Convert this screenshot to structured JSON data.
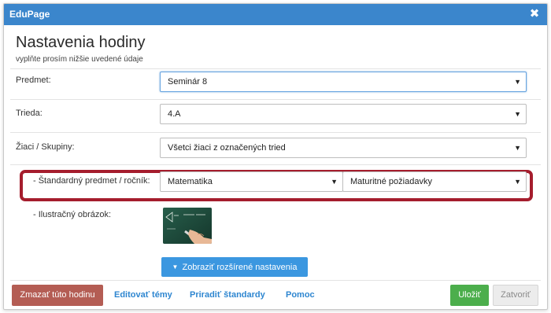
{
  "window": {
    "app_name": "EduPage",
    "close_glyph": "✖"
  },
  "header": {
    "title": "Nastavenia hodiny",
    "subtitle": "vyplňte prosím nižšie uvedené údaje"
  },
  "form": {
    "subject": {
      "label": "Predmet:",
      "value": "Seminár 8"
    },
    "class": {
      "label": "Trieda:",
      "value": "4.A"
    },
    "students": {
      "label": "Žiaci / Skupiny:",
      "value": "Všetci žiaci z označených tried"
    },
    "standard": {
      "label": "- Štandardný predmet / ročník:",
      "subject_value": "Matematika",
      "level_value": "Maturitné požiadavky"
    },
    "illustration": {
      "label": "- Ilustračný obrázok:"
    },
    "dropdown_glyph": "▼"
  },
  "buttons": {
    "show_advanced": "Zobraziť rozšírené nastavenia",
    "show_advanced_glyph": "▼",
    "delete": "Zmazať túto hodinu",
    "edit_topics": "Editovať témy",
    "assign_standards": "Priradiť štandardy",
    "help": "Pomoc",
    "save": "Uložiť",
    "close": "Zatvoriť"
  },
  "colors": {
    "titlebar": "#3b86cc",
    "highlight": "#a51d2d",
    "save": "#4cae4c",
    "delete": "#b45d54",
    "link": "#2e86d0"
  }
}
